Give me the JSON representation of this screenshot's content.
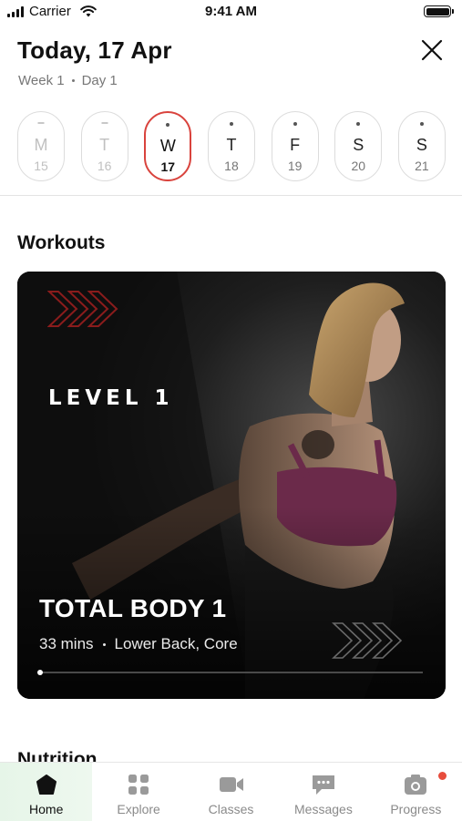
{
  "status_bar": {
    "carrier": "Carrier",
    "time": "9:41 AM"
  },
  "header": {
    "title": "Today, 17 Apr",
    "week": "Week 1",
    "day": "Day 1",
    "close_icon": "close-icon"
  },
  "days": [
    {
      "letter": "M",
      "num": "15",
      "state": "past"
    },
    {
      "letter": "T",
      "num": "16",
      "state": "past"
    },
    {
      "letter": "W",
      "num": "17",
      "state": "selected"
    },
    {
      "letter": "T",
      "num": "18",
      "state": "future"
    },
    {
      "letter": "F",
      "num": "19",
      "state": "future"
    },
    {
      "letter": "S",
      "num": "20",
      "state": "future"
    },
    {
      "letter": "S",
      "num": "21",
      "state": "future"
    }
  ],
  "workouts": {
    "section_title": "Workouts",
    "card": {
      "level": "LEVEL 1",
      "title": "TOTAL BODY 1",
      "duration": "33 mins",
      "focus": "Lower Back, Core",
      "progress": 0,
      "accent_color": "#8a1c1c"
    }
  },
  "nutrition": {
    "section_title": "Nutrition"
  },
  "tabs": [
    {
      "label": "Home",
      "icon": "home-icon",
      "active": true
    },
    {
      "label": "Explore",
      "icon": "explore-grid-icon",
      "active": false
    },
    {
      "label": "Classes",
      "icon": "video-camera-icon",
      "active": false
    },
    {
      "label": "Messages",
      "icon": "chat-bubble-icon",
      "active": false
    },
    {
      "label": "Progress",
      "icon": "camera-icon",
      "active": false,
      "badge": true
    }
  ],
  "colors": {
    "selected_ring": "#d9433d",
    "badge": "#e74c3c",
    "active_tab_bg": "#e6f5e8"
  }
}
